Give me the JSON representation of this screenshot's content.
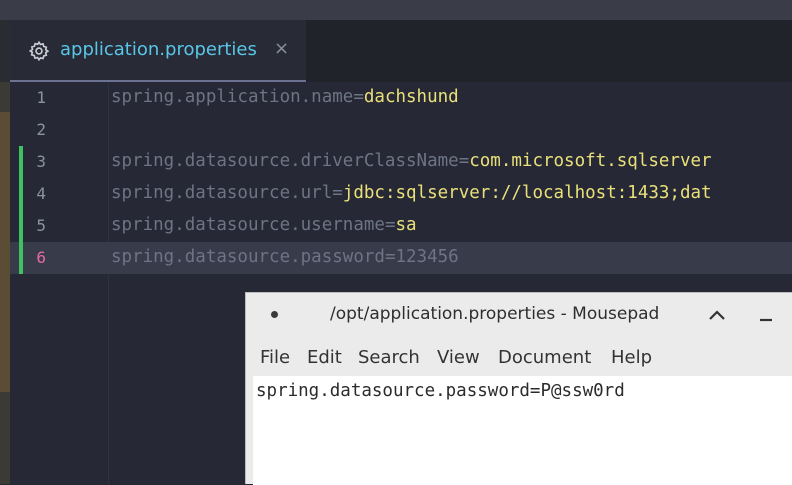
{
  "ide": {
    "tab": {
      "icon": "gear-icon",
      "label": "application.properties",
      "close": "×"
    },
    "lines": [
      {
        "num": "1",
        "key": "spring.application.name",
        "eq": "=",
        "val": "dachshund",
        "modified": false
      },
      {
        "num": "2",
        "key": "",
        "eq": "",
        "val": "",
        "modified": false
      },
      {
        "num": "3",
        "key": "spring.datasource.driverClassName",
        "eq": "=",
        "val": "com.microsoft.sqlserver",
        "modified": true
      },
      {
        "num": "4",
        "key": "spring.datasource.url",
        "eq": "=",
        "val": "jdbc:sqlserver://localhost:1433;dat",
        "modified": true
      },
      {
        "num": "5",
        "key": "spring.datasource.username",
        "eq": "=",
        "val": "sa",
        "modified": true
      },
      {
        "num": "6",
        "key": "spring.datasource.password",
        "eq": "=",
        "val": "123456",
        "modified": true,
        "current": true
      }
    ]
  },
  "mousepad": {
    "title": "/opt/application.properties - Mousepad",
    "menu": [
      "File",
      "Edit",
      "Search",
      "View",
      "Document",
      "Help"
    ],
    "content": "spring.datasource.password=P@ssw0rd"
  },
  "colors": {
    "accent_tab": "#59c6e8",
    "current_line_num": "#e36aa5",
    "modified_marker": "#3ec160",
    "value_text": "#e9e07a"
  }
}
